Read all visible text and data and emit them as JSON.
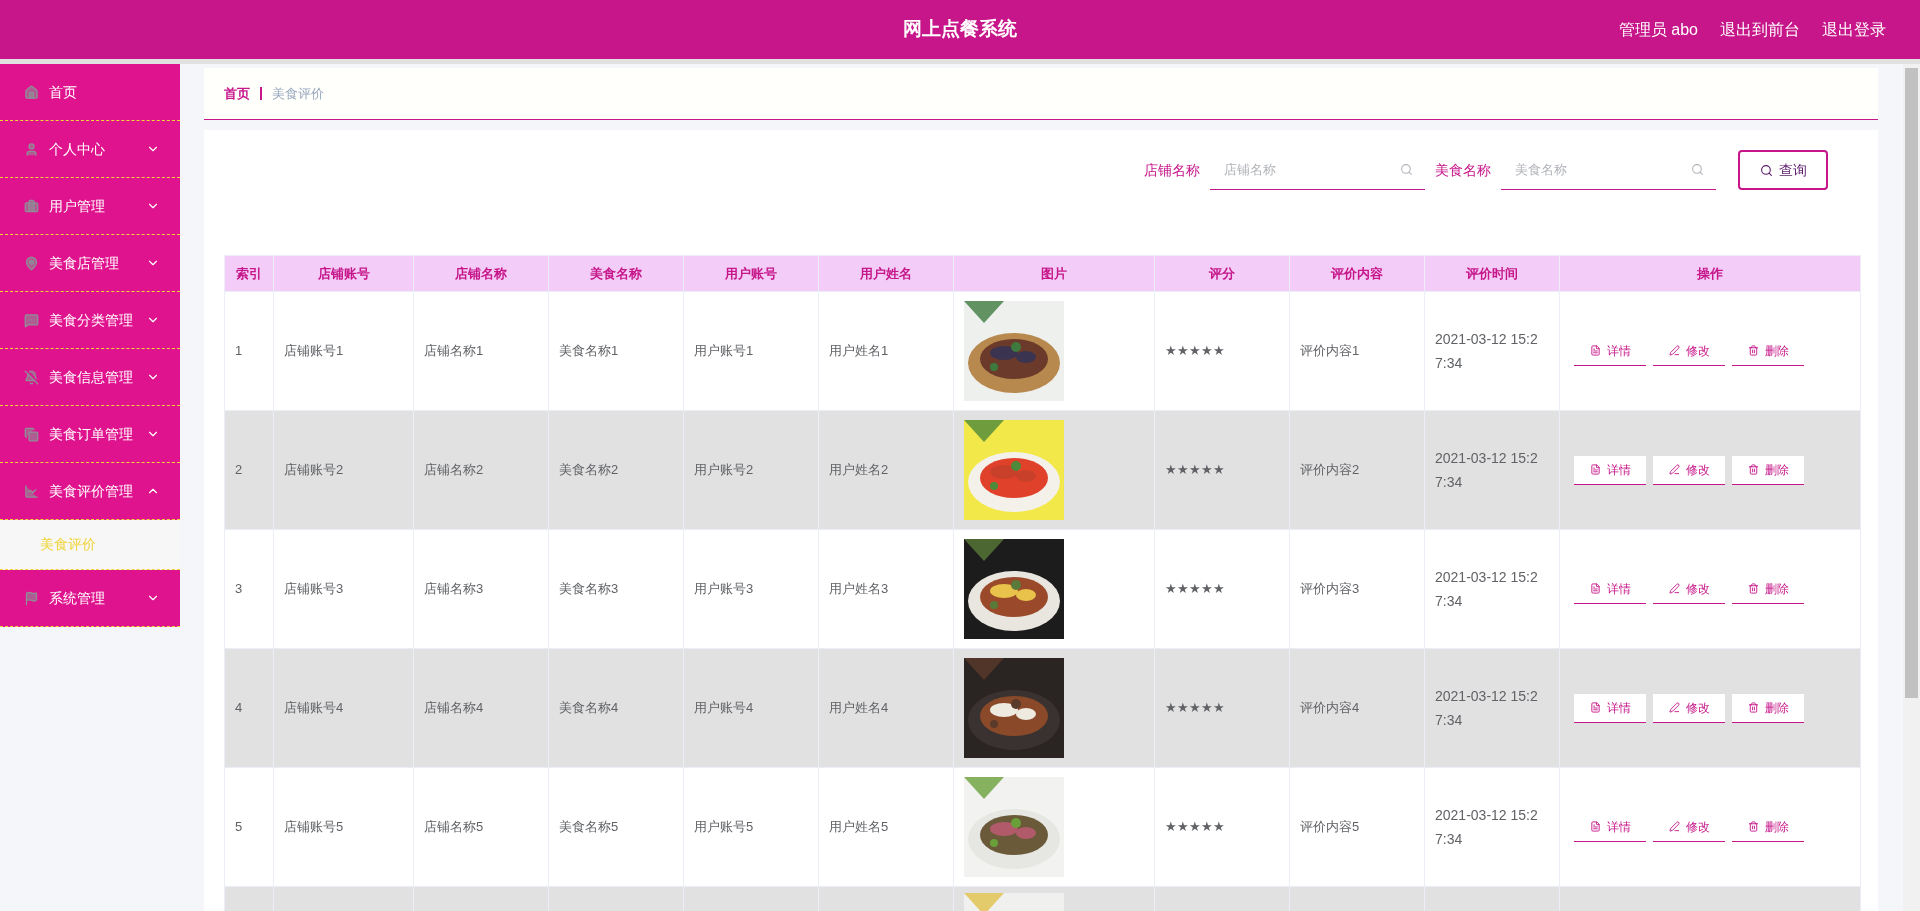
{
  "header": {
    "title": "网上点餐系统",
    "links": [
      "管理员 abo",
      "退出到前台",
      "退出登录"
    ]
  },
  "sidebar": {
    "items": [
      {
        "label": "首页"
      },
      {
        "label": "个人中心",
        "expanded": false
      },
      {
        "label": "用户管理",
        "expanded": false
      },
      {
        "label": "美食店管理",
        "expanded": false
      },
      {
        "label": "美食分类管理",
        "expanded": false
      },
      {
        "label": "美食信息管理",
        "expanded": false
      },
      {
        "label": "美食订单管理",
        "expanded": false
      },
      {
        "label": "美食评价管理",
        "expanded": true,
        "children": [
          {
            "label": "美食评价",
            "selected": true
          }
        ]
      },
      {
        "label": "系统管理",
        "expanded": false
      }
    ]
  },
  "breadcrumb": [
    "首页",
    "美食评价"
  ],
  "search": {
    "fields": [
      {
        "label": "店铺名称",
        "placeholder": "店铺名称"
      },
      {
        "label": "美食名称",
        "placeholder": "美食名称"
      }
    ],
    "button": "查询"
  },
  "table": {
    "columns": [
      "索引",
      "店铺账号",
      "店铺名称",
      "美食名称",
      "用户账号",
      "用户姓名",
      "图片",
      "评分",
      "评价内容",
      "评价时间",
      "操作"
    ],
    "rows": [
      {
        "kind": "full",
        "cells": [
          "1",
          "店铺账号1",
          "店铺名称1",
          "美食名称1",
          "用户账号1",
          "用户姓名1"
        ],
        "rating": "★★★★★",
        "content": "评价内容1",
        "time": "2021-03-12 15:27:34",
        "actions": [
          "详情",
          "修改",
          "删除"
        ]
      },
      {
        "kind": "full",
        "cells": [
          "2",
          "店铺账号2",
          "店铺名称2",
          "美食名称2",
          "用户账号2",
          "用户姓名2"
        ],
        "rating": "★★★★★",
        "content": "评价内容2",
        "time": "2021-03-12 15:27:34",
        "actions": [
          "详情",
          "修改",
          "删除"
        ]
      },
      {
        "kind": "full",
        "cells": [
          "3",
          "店铺账号3",
          "店铺名称3",
          "美食名称3",
          "用户账号3",
          "用户姓名3"
        ],
        "rating": "★★★★★",
        "content": "评价内容3",
        "time": "2021-03-12 15:27:34",
        "actions": [
          "详情",
          "修改",
          "删除"
        ]
      },
      {
        "kind": "full",
        "cells": [
          "4",
          "店铺账号4",
          "店铺名称4",
          "美食名称4",
          "用户账号4",
          "用户姓名4"
        ],
        "rating": "★★★★★",
        "content": "评价内容4",
        "time": "2021-03-12 15:27:34",
        "actions": [
          "详情",
          "修改",
          "删除"
        ]
      },
      {
        "kind": "full",
        "cells": [
          "5",
          "店铺账号5",
          "店铺名称5",
          "美食名称5",
          "用户账号5",
          "用户姓名5"
        ],
        "rating": "★★★★★",
        "content": "评价内容5",
        "time": "2021-03-12 15:27:34",
        "actions": [
          "详情",
          "修改",
          "删除"
        ]
      },
      {
        "kind": "partial"
      }
    ]
  }
}
